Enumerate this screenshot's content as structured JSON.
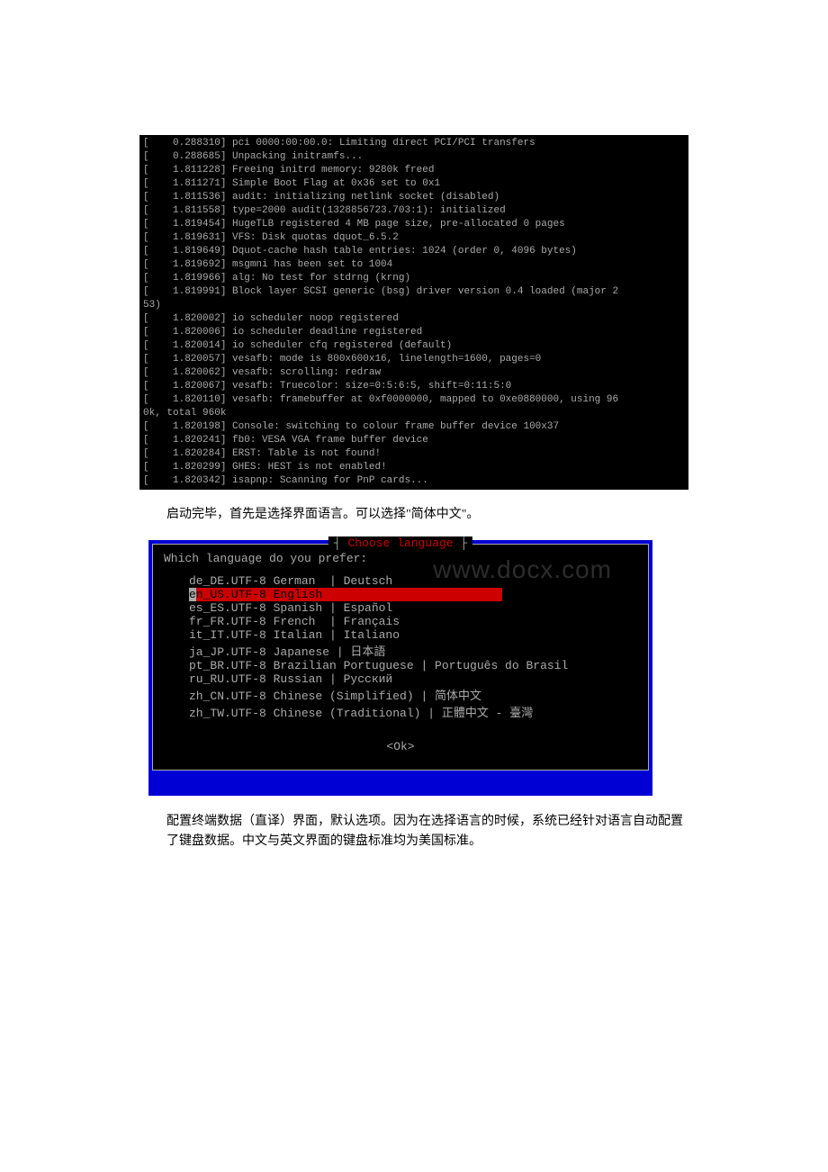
{
  "boot_log": [
    "[    0.288310] pci 0000:00:00.0: Limiting direct PCI/PCI transfers",
    "[    0.288685] Unpacking initramfs...",
    "[    1.811228] Freeing initrd memory: 9280k freed",
    "[    1.811271] Simple Boot Flag at 0x36 set to 0x1",
    "[    1.811536] audit: initializing netlink socket (disabled)",
    "[    1.811558] type=2000 audit(1328856723.703:1): initialized",
    "[    1.819454] HugeTLB registered 4 MB page size, pre-allocated 0 pages",
    "[    1.819631] VFS: Disk quotas dquot_6.5.2",
    "[    1.819649] Dquot-cache hash table entries: 1024 (order 0, 4096 bytes)",
    "[    1.819692] msgmni has been set to 1004",
    "[    1.819966] alg: No test for stdrng (krng)",
    "[    1.819991] Block layer SCSI generic (bsg) driver version 0.4 loaded (major 2",
    "53)",
    "[    1.820002] io scheduler noop registered",
    "[    1.820006] io scheduler deadline registered",
    "[    1.820014] io scheduler cfq registered (default)",
    "[    1.820057] vesafb: mode is 800x600x16, linelength=1600, pages=0",
    "[    1.820062] vesafb: scrolling: redraw",
    "[    1.820067] vesafb: Truecolor: size=0:5:6:5, shift=0:11:5:0",
    "[    1.820110] vesafb: framebuffer at 0xf0000000, mapped to 0xe0880000, using 96",
    "0k, total 960k",
    "[    1.820198] Console: switching to colour frame buffer device 100x37",
    "[    1.820241] fb0: VESA VGA frame buffer device",
    "[    1.820284] ERST: Table is not found!",
    "[    1.820299] GHES: HEST is not enabled!",
    "[    1.820342] isapnp: Scanning for PnP cards..."
  ],
  "caption1": "启动完毕，首先是选择界面语言。可以选择\"简体中文\"。",
  "dialog": {
    "title": "Choose language",
    "prompt": "Which language do you prefer:",
    "languages": [
      {
        "code": "de_DE.UTF-8",
        "label": "German  | Deutsch"
      },
      {
        "code": "en_US.UTF-8",
        "label": "English"
      },
      {
        "code": "es_ES.UTF-8",
        "label": "Spanish | Español"
      },
      {
        "code": "fr_FR.UTF-8",
        "label": "French  | Français"
      },
      {
        "code": "it_IT.UTF-8",
        "label": "Italian | Italiano"
      },
      {
        "code": "ja_JP.UTF-8",
        "label": "Japanese | 日本語"
      },
      {
        "code": "pt_BR.UTF-8",
        "label": "Brazilian Portuguese | Português do Brasil"
      },
      {
        "code": "ru_RU.UTF-8",
        "label": "Russian | Русский"
      },
      {
        "code": "zh_CN.UTF-8",
        "label": "Chinese (Simplified) | 简体中文"
      },
      {
        "code": "zh_TW.UTF-8",
        "label": "Chinese (Traditional) | 正體中文 - 臺灣"
      }
    ],
    "selected_index": 1,
    "ok_label": "<Ok>"
  },
  "watermark": "www.docx.com",
  "caption2": "        配置终端数据（直译）界面，默认选项。因为在选择语言的时候，系统已经针对语言自动配置了键盘数据。中文与英文界面的键盘标准均为美国标准。"
}
